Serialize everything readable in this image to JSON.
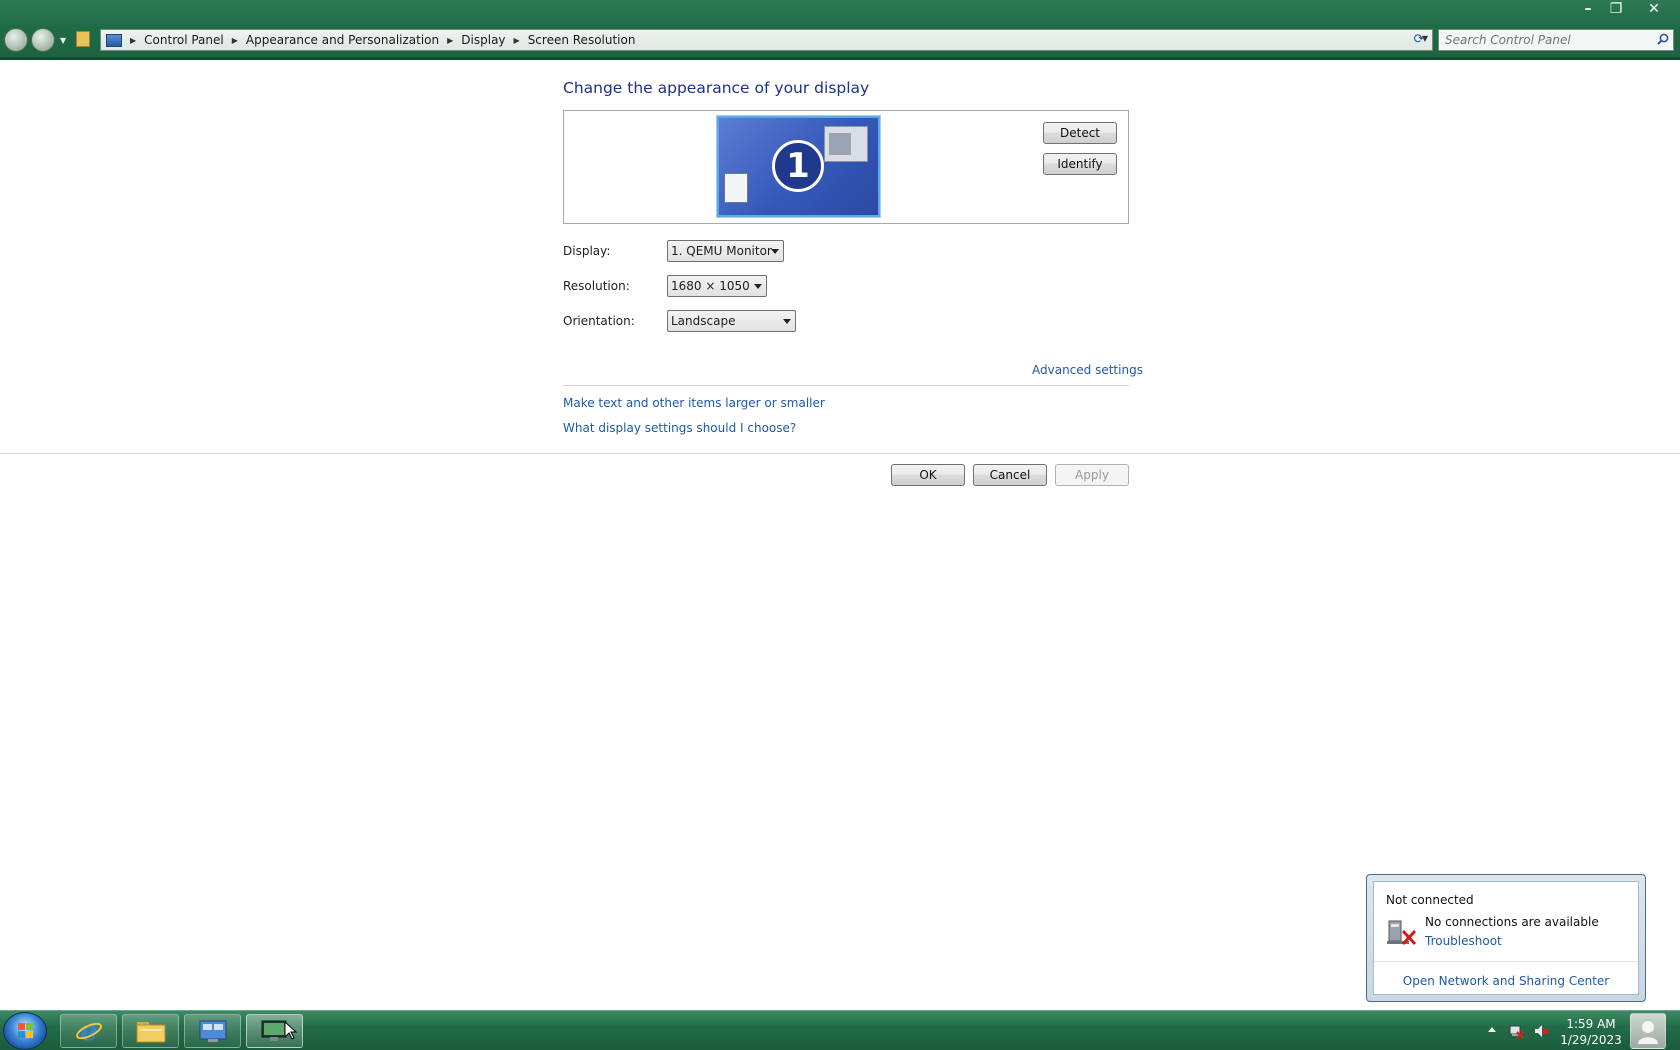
{
  "window": {
    "breadcrumb": [
      "Control Panel",
      "Appearance and Personalization",
      "Display",
      "Screen Resolution"
    ],
    "search_placeholder": "Search Control Panel",
    "controls": {
      "minimize": "–",
      "maximize": "❐",
      "close": "✕"
    }
  },
  "main": {
    "heading": "Change the appearance of your display",
    "monitor_number": "1",
    "detect_label": "Detect",
    "identify_label": "Identify",
    "display_label": "Display:",
    "display_value": "1. QEMU Monitor",
    "resolution_label": "Resolution:",
    "resolution_value": "1680 × 1050",
    "orientation_label": "Orientation:",
    "orientation_value": "Landscape",
    "advanced_link": "Advanced settings",
    "text_size_link": "Make text and other items larger or smaller",
    "help_link": "What display settings should I choose?",
    "ok_label": "OK",
    "cancel_label": "Cancel",
    "apply_label": "Apply"
  },
  "network_popup": {
    "title": "Not connected",
    "message": "No connections are available",
    "troubleshoot": "Troubleshoot",
    "open_center": "Open Network and Sharing Center"
  },
  "taskbar": {
    "items": [
      "internet-explorer",
      "file-explorer",
      "control-panel",
      "screen-resolution"
    ],
    "time": "1:59 AM",
    "date": "1/29/2023"
  },
  "colors": {
    "link": "#1e5aa8",
    "heading": "#1e3287",
    "chrome_green": "#1f6b47"
  }
}
